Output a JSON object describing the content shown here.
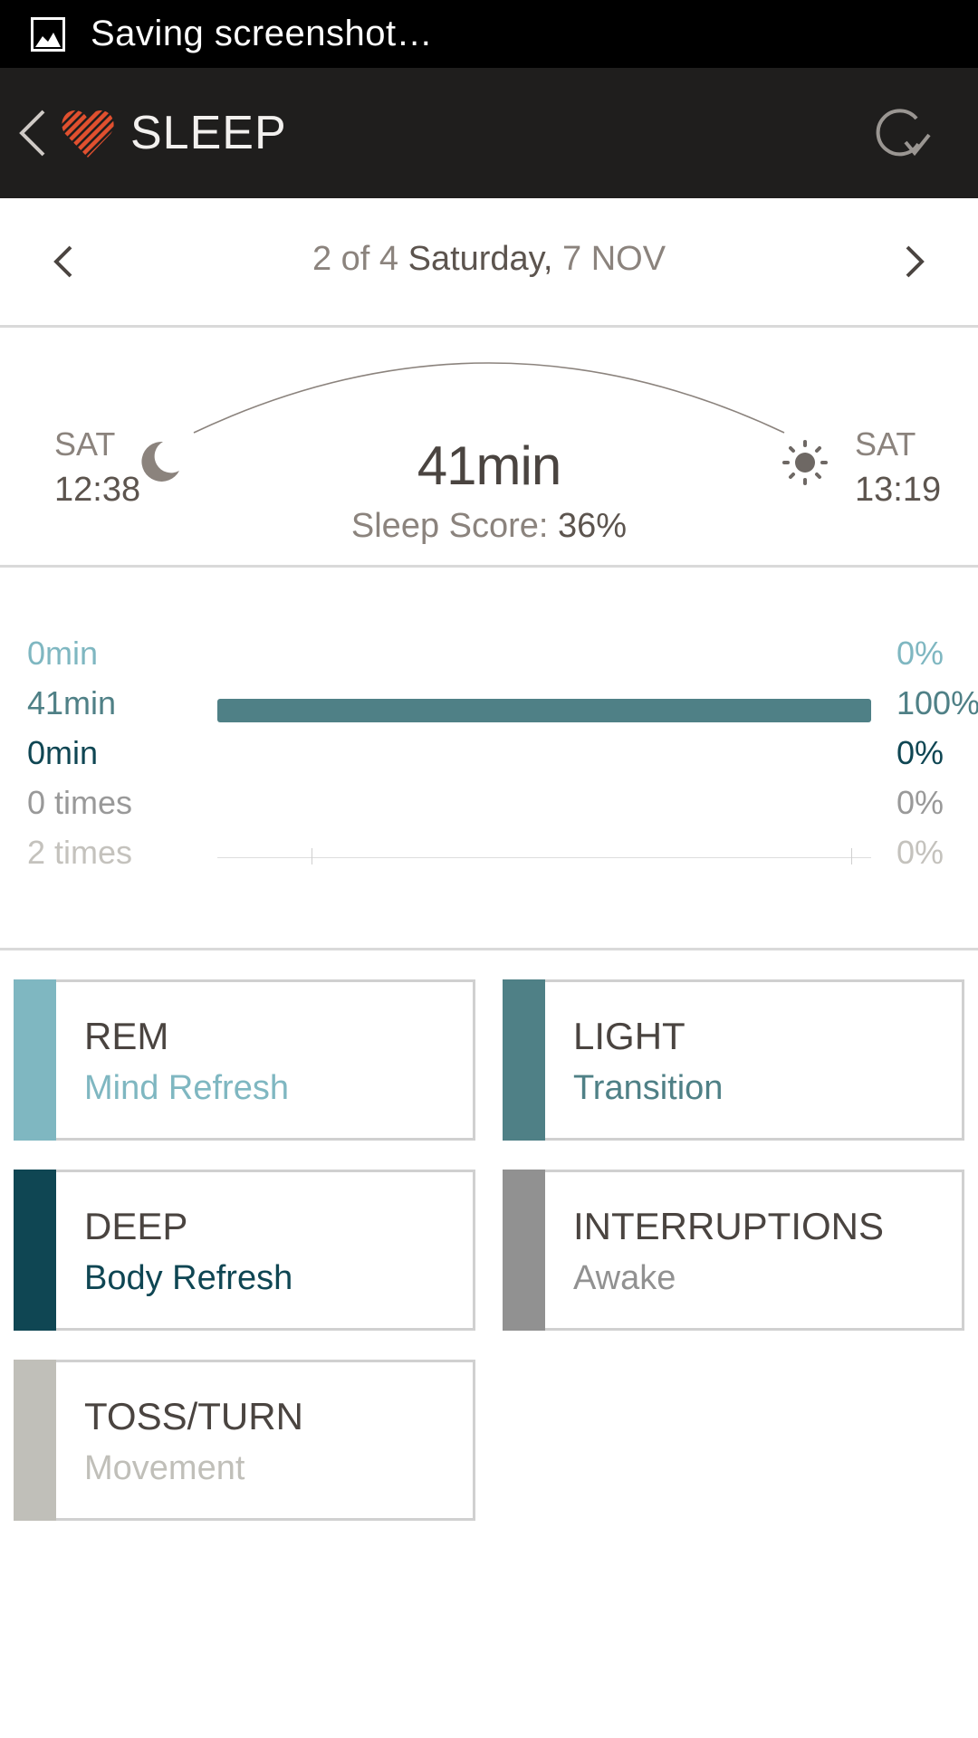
{
  "status_bar": {
    "text": "Saving screenshot…"
  },
  "app_bar": {
    "title": "SLEEP"
  },
  "date_nav": {
    "position": "2 of 4",
    "day": "Saturday,",
    "date": "7 NOV"
  },
  "summary": {
    "start_day": "SAT",
    "start_time": "12:38",
    "end_day": "SAT",
    "end_time": "13:19",
    "duration": "41min",
    "score_label": "Sleep Score:",
    "score_value": "36%"
  },
  "stage_rows": [
    {
      "left": "0min",
      "right": "0%",
      "color": "#7fb7c1",
      "fill": 0
    },
    {
      "left": "41min",
      "right": "100%",
      "color": "#4f8086",
      "fill": 1.0
    },
    {
      "left": "0min",
      "right": "0%",
      "color": "#0f4653",
      "fill": 0
    },
    {
      "left": "0 times",
      "right": "0%",
      "color": "#999999",
      "fill": 0
    },
    {
      "left": "2 times",
      "right": "0%",
      "color": "#c4c2bd",
      "fill": 0
    }
  ],
  "cards": [
    {
      "title": "REM",
      "subtitle": "Mind Refresh",
      "color": "#7fb7c1"
    },
    {
      "title": "LIGHT",
      "subtitle": "Transition",
      "color": "#4f8086"
    },
    {
      "title": "DEEP",
      "subtitle": "Body Refresh",
      "color": "#0f4653"
    },
    {
      "title": "INTERRUPTIONS",
      "subtitle": "Awake",
      "color": "#919191"
    },
    {
      "title": "TOSS/TURN",
      "subtitle": "Movement",
      "color": "#c0bfb9"
    }
  ]
}
